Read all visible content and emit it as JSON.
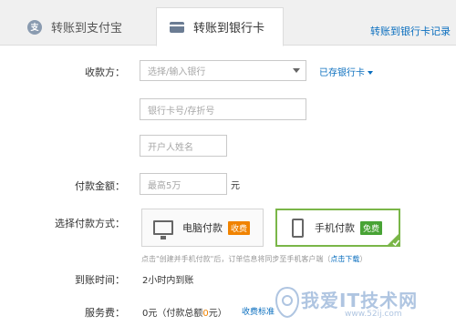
{
  "tabs": {
    "alipay_icon_char": "支",
    "alipay": "转账到支付宝",
    "bank": "转账到银行卡",
    "records": "转账到银行卡记录"
  },
  "form": {
    "payee_label": "收款方：",
    "bank_select_placeholder": "选择/输入银行",
    "saved_cards": "已存银行卡",
    "card_number_placeholder": "银行卡号/存折号",
    "holder_name_placeholder": "开户人姓名",
    "amount_label": "付款金额：",
    "amount_placeholder": "最高5万",
    "amount_unit": "元",
    "method_label": "选择付款方式：",
    "pc_pay": "电脑付款",
    "pc_badge": "收费",
    "mobile_pay": "手机付款",
    "mobile_badge": "免费",
    "hint_text": "点击\"创建并手机付款\"后，订单信息将同步至手机客户端（",
    "hint_link": "点击下载",
    "hint_end": "）",
    "arrival_label": "到账时间：",
    "arrival_value": "2小时内到账",
    "fee_label": "服务费：",
    "fee_value_prefix": "0元（付款总额",
    "fee_value_zero": "0",
    "fee_value_suffix": "元）",
    "fee_standard_link": "收费标准"
  },
  "watermark": {
    "text": "我爱IT技术网",
    "url": "www.52ij.com"
  },
  "colors": {
    "link": "#0b6fbf",
    "selected_border": "#7ab648",
    "fee_badge": "#f08300",
    "free_badge": "#48a335"
  }
}
